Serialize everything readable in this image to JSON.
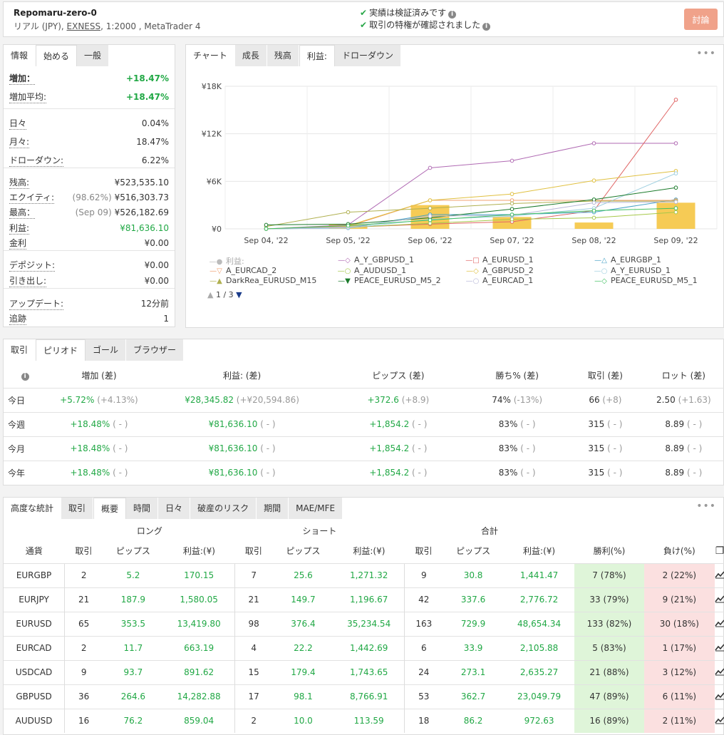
{
  "header": {
    "account_name": "Repomaru-zero-0",
    "sub_prefix": "リアル (JPY), ",
    "broker": "EXNESS",
    "sub_suffix": ", 1:2000 , MetaTrader 4",
    "verified_1": "実績は検証済みです",
    "verified_2": "取引の特権が確認されました",
    "discuss_label": "討論"
  },
  "info": {
    "tabs": [
      "情報",
      "始める",
      "一般"
    ],
    "rows": [
      {
        "k": "増加：",
        "v": "+18.47%"
      },
      {
        "k": "増加平均:",
        "v": "+18.47%"
      },
      {
        "k": "日々",
        "v": "0.04%"
      },
      {
        "k": "月々:",
        "v": "18.47%"
      },
      {
        "k": "ドローダウン:",
        "v": "6.22%"
      },
      {
        "k": "残高:",
        "v": "¥523,535.10"
      },
      {
        "k": "エクイティ:",
        "pre": "(98.62%)",
        "v": "¥516,303.73"
      },
      {
        "k": "最高：",
        "pre": "(Sep 09)",
        "v": "¥526,182.69"
      },
      {
        "k": "利益:",
        "v": "¥81,636.10"
      },
      {
        "k": "金利",
        "v": "¥0.00"
      },
      {
        "k": "デポジット:",
        "v": "¥0.00"
      },
      {
        "k": "引き出し:",
        "v": "¥0.00"
      },
      {
        "k": "アップデート:",
        "v": "12分前"
      },
      {
        "k": "追跡",
        "v": "1"
      }
    ]
  },
  "chart_panel": {
    "tabs": [
      "チャート",
      "成長",
      "残高",
      "利益:",
      "ドローダウン"
    ],
    "pager": "1 / 3"
  },
  "chart_data": {
    "type": "line",
    "categories": [
      "Sep 04, '22",
      "Sep 05, '22",
      "Sep 06, '22",
      "Sep 07, '22",
      "Sep 08, '22",
      "Sep 09, '22"
    ],
    "y_ticks": [
      "¥0",
      "¥6K",
      "¥12K",
      "¥18K"
    ],
    "ylim": [
      0,
      18000
    ],
    "bars": {
      "name": "利益:",
      "color": "#f5c542",
      "values": [
        0,
        600,
        3000,
        1500,
        800,
        3300
      ]
    },
    "series": [
      {
        "name": "A_Y_GBPUSD_1",
        "color": "#b06ab3",
        "marker": "◇",
        "values": [
          0,
          500,
          7700,
          8600,
          10800,
          10800
        ]
      },
      {
        "name": "A_EURUSD_1",
        "color": "#e06666",
        "marker": "□",
        "values": [
          0,
          200,
          600,
          900,
          2300,
          16300
        ]
      },
      {
        "name": "A_EURGBP_1",
        "color": "#4aa3c7",
        "marker": "△",
        "values": [
          0,
          100,
          1800,
          1800,
          2100,
          3700
        ]
      },
      {
        "name": "A_EURCAD_2",
        "color": "#f0a070",
        "marker": "▽",
        "values": [
          0,
          300,
          3600,
          3600,
          3600,
          3600
        ]
      },
      {
        "name": "A_AUDUSD_1",
        "color": "#a6c84a",
        "marker": "○",
        "values": [
          0,
          200,
          700,
          1200,
          1400,
          2100
        ]
      },
      {
        "name": "A_GBPUSD_2",
        "color": "#e0c040",
        "marker": "◇",
        "values": [
          0,
          400,
          3600,
          4400,
          6100,
          7300
        ]
      },
      {
        "name": "A_Y_EURUSD_1",
        "color": "#9fcfe0",
        "marker": "○",
        "values": [
          0,
          100,
          1200,
          1600,
          2600,
          7000
        ]
      },
      {
        "name": "DarkRea_EURUSD_M15",
        "color": "#b0b050",
        "marker": "▲",
        "values": [
          300,
          2100,
          2600,
          3200,
          3500,
          3500
        ]
      },
      {
        "name": "PEACE_EURUSD_M5_2",
        "color": "#1a7a2a",
        "marker": "▼",
        "values": [
          500,
          600,
          1400,
          2500,
          3700,
          5200
        ]
      },
      {
        "name": "A_EURCAD_1",
        "color": "#b8b8d8",
        "marker": "○",
        "values": [
          0,
          200,
          1600,
          1700,
          3300,
          3400
        ]
      },
      {
        "name": "PEACE_EURUSD_M5_1",
        "color": "#40c060",
        "marker": "◇",
        "values": [
          0,
          400,
          1100,
          1800,
          2300,
          2600
        ]
      }
    ]
  },
  "period": {
    "tabs": [
      "取引",
      "ピリオド",
      "ゴール",
      "ブラウザー"
    ],
    "headers": [
      "増加 (差)",
      "利益: (差)",
      "ピップス (差)",
      "勝ち% (差)",
      "取引 (差)",
      "ロット (差)"
    ],
    "rows": [
      {
        "label": "今日",
        "cells": [
          [
            "+5.72%",
            "(+4.13%)"
          ],
          [
            "¥28,345.82",
            "(+¥20,594.86)"
          ],
          [
            "+372.6",
            "(+8.9)"
          ],
          [
            "74%",
            "(-13%)"
          ],
          [
            "66",
            "(+8)"
          ],
          [
            "2.50",
            "(+1.63)"
          ]
        ]
      },
      {
        "label": "今週",
        "cells": [
          [
            "+18.48%",
            "( - )"
          ],
          [
            "¥81,636.10",
            "( - )"
          ],
          [
            "+1,854.2",
            "( - )"
          ],
          [
            "83%",
            "( - )"
          ],
          [
            "315",
            "( - )"
          ],
          [
            "8.89",
            "( - )"
          ]
        ]
      },
      {
        "label": "今月",
        "cells": [
          [
            "+18.48%",
            "( - )"
          ],
          [
            "¥81,636.10",
            "( - )"
          ],
          [
            "+1,854.2",
            "( - )"
          ],
          [
            "83%",
            "( - )"
          ],
          [
            "315",
            "( - )"
          ],
          [
            "8.89",
            "( - )"
          ]
        ]
      },
      {
        "label": "今年",
        "cells": [
          [
            "+18.48%",
            "( - )"
          ],
          [
            "¥81,636.10",
            "( - )"
          ],
          [
            "+1,854.2",
            "( - )"
          ],
          [
            "83%",
            "( - )"
          ],
          [
            "315",
            "( - )"
          ],
          [
            "8.89",
            "( - )"
          ]
        ]
      }
    ]
  },
  "advanced": {
    "tabs": [
      "高度な統計",
      "取引",
      "概要",
      "時間",
      "日々",
      "破産のリスク",
      "期間",
      "MAE/MFE"
    ],
    "groups": [
      "ロング",
      "ショート",
      "合計"
    ],
    "headers": [
      "通貨",
      "取引",
      "ピップス",
      "利益:(¥)",
      "取引",
      "ピップス",
      "利益:(¥)",
      "取引",
      "ピップス",
      "利益:(¥)",
      "勝利(%)",
      "負け(%)"
    ],
    "rows": [
      [
        "EURGBP",
        "2",
        "5.2",
        "170.15",
        "7",
        "25.6",
        "1,271.32",
        "9",
        "30.8",
        "1,441.47",
        "7 (78%)",
        "2 (22%)"
      ],
      [
        "EURJPY",
        "21",
        "187.9",
        "1,580.05",
        "21",
        "149.7",
        "1,196.67",
        "42",
        "337.6",
        "2,776.72",
        "33 (79%)",
        "9 (21%)"
      ],
      [
        "EURUSD",
        "65",
        "353.5",
        "13,419.80",
        "98",
        "376.4",
        "35,234.54",
        "163",
        "729.9",
        "48,654.34",
        "133 (82%)",
        "30 (18%)"
      ],
      [
        "EURCAD",
        "2",
        "11.7",
        "663.19",
        "4",
        "22.2",
        "1,442.69",
        "6",
        "33.9",
        "2,105.88",
        "5 (83%)",
        "1 (17%)"
      ],
      [
        "USDCAD",
        "9",
        "93.7",
        "891.62",
        "15",
        "179.4",
        "1,743.65",
        "24",
        "273.1",
        "2,635.27",
        "21 (88%)",
        "3 (12%)"
      ],
      [
        "GBPUSD",
        "36",
        "264.6",
        "14,282.88",
        "17",
        "98.1",
        "8,766.91",
        "53",
        "362.7",
        "23,049.79",
        "47 (89%)",
        "6 (11%)"
      ],
      [
        "AUDUSD",
        "16",
        "76.2",
        "859.04",
        "2",
        "10.0",
        "113.59",
        "18",
        "86.2",
        "972.63",
        "16 (89%)",
        "2 (11%)"
      ]
    ]
  }
}
